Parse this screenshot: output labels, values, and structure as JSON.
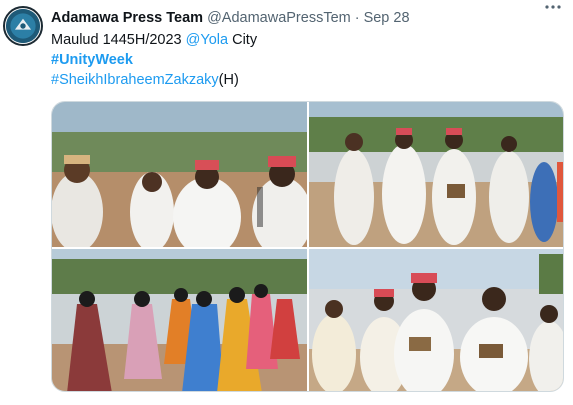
{
  "author": {
    "name": "Adamawa Press Team",
    "handle": "@AdamawaPressTem",
    "separator": "·",
    "date": "Sep 28",
    "avatar_icon": "press-logo-icon"
  },
  "more_icon": "more-horizontal-icon",
  "tweet": {
    "line1_text": "Maulud 1445H/2023 ",
    "line1_mention": "@Yola",
    "line1_suffix": " City",
    "hashtag1": "#UnityWeek",
    "hashtag2": "#SheikhIbraheemZakzaky",
    "hashtag2_suffix": "(H)"
  },
  "media": {
    "photos": [
      {
        "subject": "procession-men-white-robes"
      },
      {
        "subject": "procession-men-holding-books"
      },
      {
        "subject": "procession-women-colored-veils"
      },
      {
        "subject": "procession-men-reading-books"
      }
    ]
  },
  "colors": {
    "link": "#1d9bf0",
    "text": "#0f1419",
    "secondary": "#536471",
    "border": "#cfd9de"
  }
}
